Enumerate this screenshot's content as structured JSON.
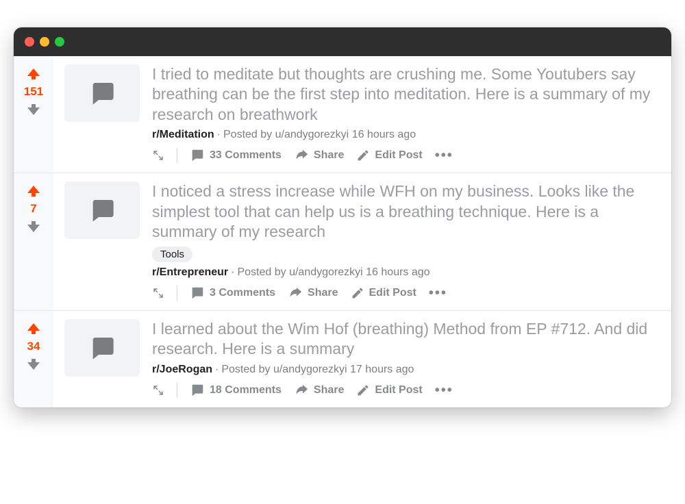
{
  "posts": [
    {
      "score": "151",
      "title": "I tried to meditate but thoughts are crushing me. Some Youtubers say breathing can be the first step into meditation. Here is a summary of my research on breathwork",
      "flair": null,
      "subreddit": "r/Meditation",
      "posted_by_prefix": "Posted by ",
      "author": "u/andygorezkyi",
      "age": "16 hours ago",
      "comments_label": "33 Comments",
      "share_label": "Share",
      "edit_label": "Edit Post"
    },
    {
      "score": "7",
      "title": "I noticed a stress increase while WFH on my business. Looks like the simplest tool that can help us is a breathing technique. Here is a summary of my research",
      "flair": "Tools",
      "subreddit": "r/Entrepreneur",
      "posted_by_prefix": "Posted by ",
      "author": "u/andygorezkyi",
      "age": "16 hours ago",
      "comments_label": "3 Comments",
      "share_label": "Share",
      "edit_label": "Edit Post"
    },
    {
      "score": "34",
      "title": "I learned about the Wim Hof (breathing) Method from EP #712. And did research. Here is a summary",
      "flair": null,
      "subreddit": "r/JoeRogan",
      "posted_by_prefix": "Posted by ",
      "author": "u/andygorezkyi",
      "age": "17 hours ago",
      "comments_label": "18 Comments",
      "share_label": "Share",
      "edit_label": "Edit Post"
    }
  ]
}
